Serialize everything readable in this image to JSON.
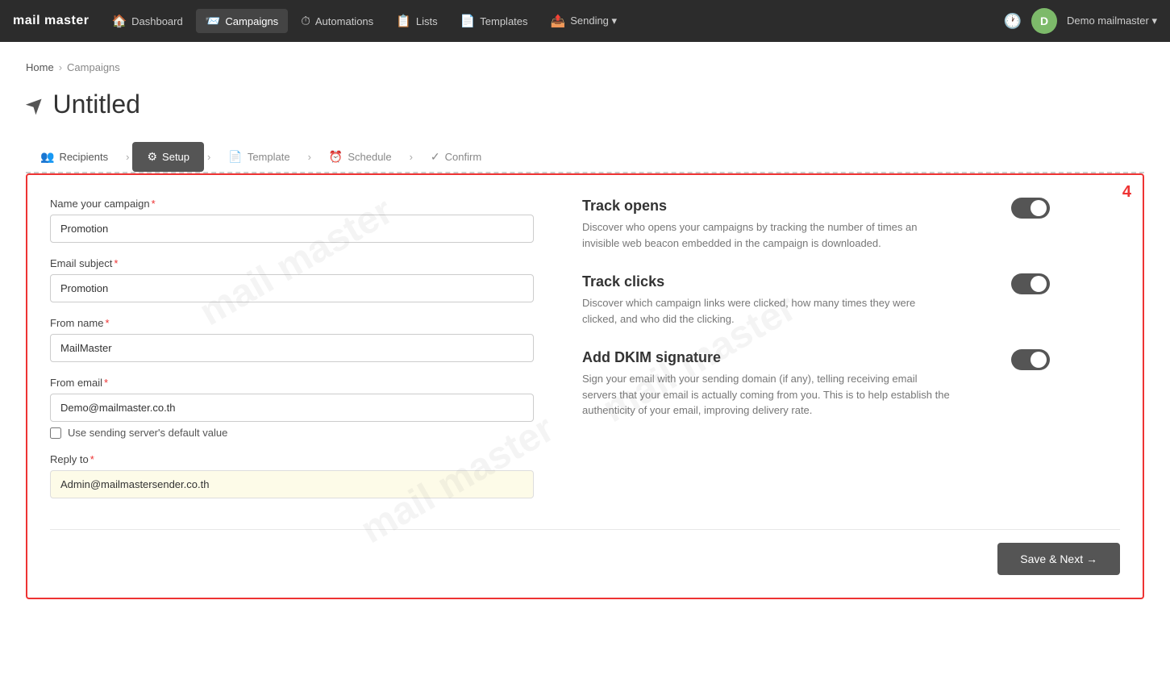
{
  "brand": "mail master",
  "nav": {
    "items": [
      {
        "label": "Dashboard",
        "icon": "🏠",
        "active": false
      },
      {
        "label": "Campaigns",
        "icon": "📨",
        "active": true
      },
      {
        "label": "Automations",
        "icon": "⏱",
        "active": false
      },
      {
        "label": "Lists",
        "icon": "📋",
        "active": false
      },
      {
        "label": "Templates",
        "icon": "📄",
        "active": false
      },
      {
        "label": "Sending ▾",
        "icon": "📤",
        "active": false
      }
    ],
    "user_label": "Demo mailmaster ▾"
  },
  "breadcrumb": {
    "home": "Home",
    "separator": "›",
    "current": "Campaigns"
  },
  "page_title": "Untitled",
  "wizard": {
    "steps": [
      {
        "label": "Recipients",
        "icon": "👥",
        "state": "done"
      },
      {
        "label": "Setup",
        "icon": "⚙",
        "state": "active"
      },
      {
        "label": "Template",
        "icon": "📄",
        "state": "pending"
      },
      {
        "label": "Schedule",
        "icon": "⏰",
        "state": "pending"
      },
      {
        "label": "Confirm",
        "icon": "✓",
        "state": "pending"
      }
    ]
  },
  "step_number": "4",
  "form": {
    "campaign_name_label": "Name your campaign",
    "campaign_name_value": "Promotion",
    "email_subject_label": "Email subject",
    "email_subject_value": "Promotion",
    "from_name_label": "From name",
    "from_name_value": "MailMaster",
    "from_email_label": "From email",
    "from_email_value": "Demo@mailmaster.co.th",
    "checkbox_label": "Use sending server's default value",
    "reply_to_label": "Reply to",
    "reply_to_value": "Admin@mailmastersender.co.th"
  },
  "tracking": {
    "track_opens_title": "Track opens",
    "track_opens_desc": "Discover who opens your campaigns by tracking the number of times an invisible web beacon embedded in the campaign is downloaded.",
    "track_clicks_title": "Track clicks",
    "track_clicks_desc": "Discover which campaign links were clicked, how many times they were clicked, and who did the clicking.",
    "dkim_title": "Add DKIM signature",
    "dkim_desc": "Sign your email with your sending domain (if any), telling receiving email servers that your email is actually coming from you. This is to help establish the authenticity of your email, improving delivery rate."
  },
  "footer": {
    "save_next_label": "Save & Next →"
  }
}
